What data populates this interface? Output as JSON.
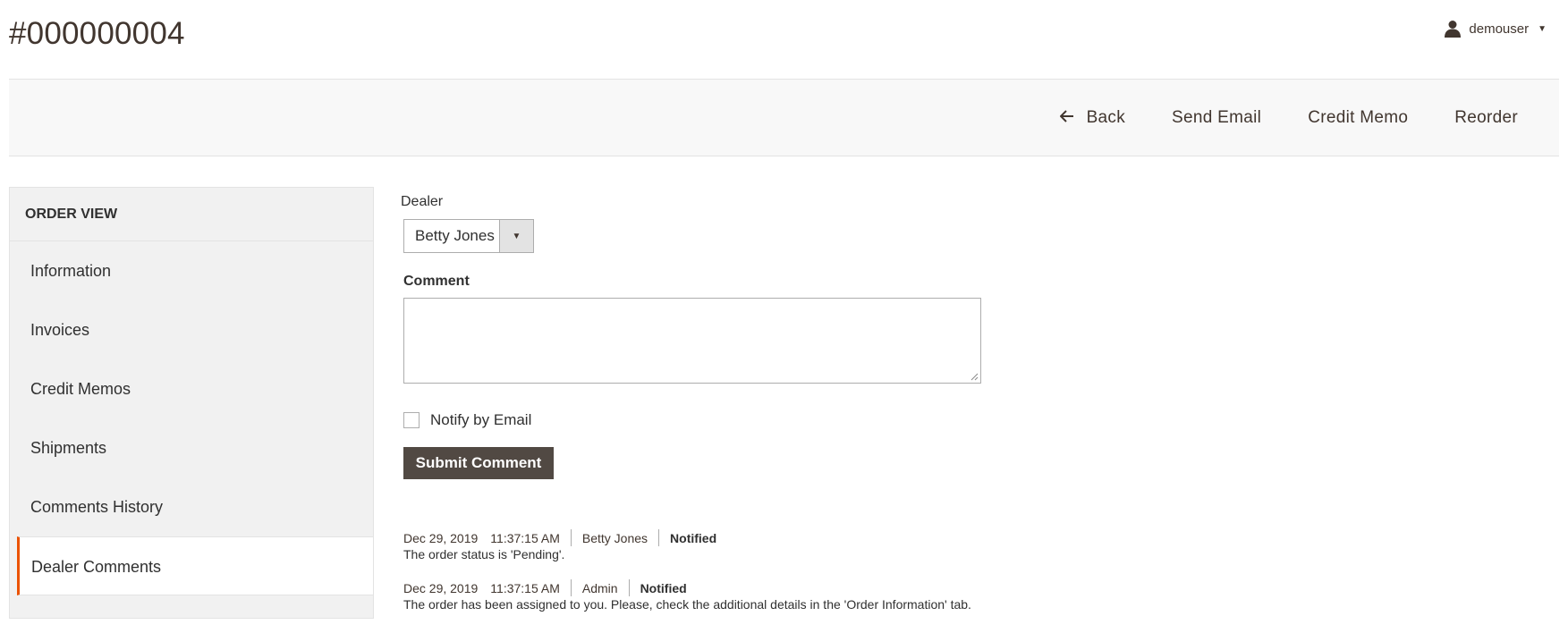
{
  "header": {
    "title": "#000000004",
    "user": {
      "name": "demouser",
      "icon": "user-icon",
      "caret_icon": "caret-down-icon"
    }
  },
  "actions": {
    "back_label": "Back",
    "back_icon": "arrow-left-icon",
    "send_email_label": "Send Email",
    "credit_memo_label": "Credit Memo",
    "reorder_label": "Reorder"
  },
  "sidebar": {
    "title": "ORDER VIEW",
    "items": [
      {
        "label": "Information"
      },
      {
        "label": "Invoices"
      },
      {
        "label": "Credit Memos"
      },
      {
        "label": "Shipments"
      },
      {
        "label": "Comments History"
      },
      {
        "label": "Dealer Comments",
        "active": true
      }
    ]
  },
  "form": {
    "dealer_label": "Dealer",
    "dealer_value": "Betty Jones",
    "comment_label": "Comment",
    "comment_value": "",
    "notify_label": "Notify by Email",
    "notify_checked": false,
    "submit_label": "Submit Comment"
  },
  "history": [
    {
      "date": "Dec 29, 2019",
      "time": "11:37:15 AM",
      "author": "Betty Jones",
      "status": "Notified",
      "text": "The order status is 'Pending'."
    },
    {
      "date": "Dec 29, 2019",
      "time": "11:37:15 AM",
      "author": "Admin",
      "status": "Notified",
      "text": "The order has been assigned to you. Please, check the additional details in the 'Order Information' tab."
    }
  ],
  "colors": {
    "accent": "#eb5202",
    "button_dark": "#514943",
    "text": "#303030"
  }
}
